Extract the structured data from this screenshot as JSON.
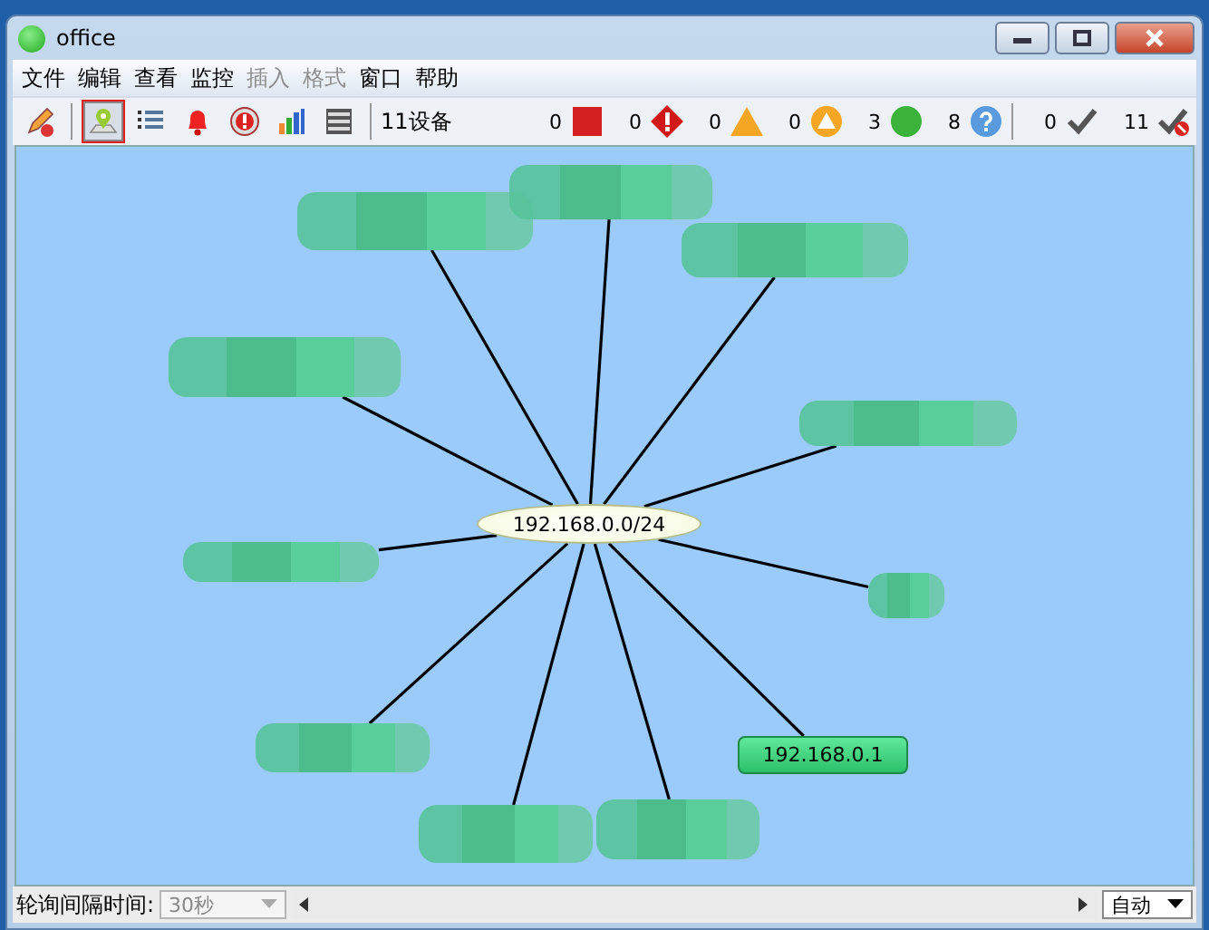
{
  "window": {
    "title": "office"
  },
  "menu": [
    {
      "label": "文件",
      "disabled": false
    },
    {
      "label": "编辑",
      "disabled": false
    },
    {
      "label": "查看",
      "disabled": false
    },
    {
      "label": "监控",
      "disabled": false
    },
    {
      "label": "插入",
      "disabled": true
    },
    {
      "label": "格式",
      "disabled": true
    },
    {
      "label": "窗口",
      "disabled": false
    },
    {
      "label": "帮助",
      "disabled": false
    }
  ],
  "toolbar": {
    "tools": [
      {
        "kind": "edit",
        "selected": false
      },
      {
        "kind": "map",
        "selected": true
      },
      {
        "kind": "list",
        "selected": false
      },
      {
        "kind": "bell",
        "selected": false
      },
      {
        "kind": "alarm",
        "selected": false
      },
      {
        "kind": "chart",
        "selected": false
      },
      {
        "kind": "table",
        "selected": false
      }
    ],
    "device_count": "11设备",
    "status_counts": [
      {
        "kind": "critical",
        "count": "0"
      },
      {
        "kind": "error",
        "count": "0"
      },
      {
        "kind": "warning",
        "count": "0"
      },
      {
        "kind": "caution",
        "count": "0"
      },
      {
        "kind": "ok",
        "count": "3"
      },
      {
        "kind": "unknown",
        "count": "8"
      },
      {
        "kind": "acked",
        "count": "0"
      },
      {
        "kind": "unacked",
        "count": "11"
      }
    ]
  },
  "map": {
    "network": "192.168.0.0/24",
    "nodes": [
      {
        "kind": "blurred"
      },
      {
        "kind": "blurred"
      },
      {
        "kind": "blurred"
      },
      {
        "kind": "blurred"
      },
      {
        "kind": "blurred"
      },
      {
        "kind": "blurred"
      },
      {
        "kind": "blurred"
      },
      {
        "kind": "blurred"
      },
      {
        "kind": "device",
        "label": "192.168.0.1"
      },
      {
        "kind": "blurred"
      },
      {
        "kind": "blurred"
      }
    ]
  },
  "status_bar": {
    "poll_label": "轮询间隔时间:",
    "poll_interval": "30秒",
    "zoom": "自动"
  }
}
